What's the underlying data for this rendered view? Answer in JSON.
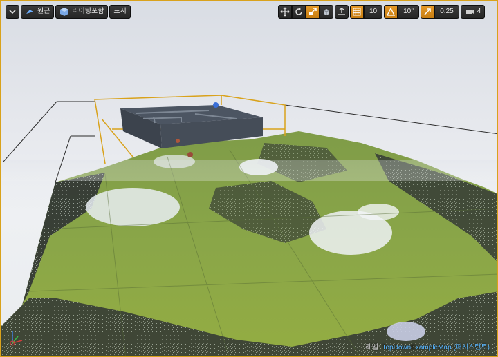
{
  "toolbar": {
    "menu_icon": "chevron-down-icon",
    "view_mode": {
      "label": "원근",
      "icon": "perspective-icon"
    },
    "lighting": {
      "label": "라이팅포함",
      "icon": "lit-sphere-icon"
    },
    "show": {
      "label": "표시"
    },
    "transform_tools": [
      "move-icon",
      "rotate-icon",
      "scale-icon"
    ],
    "world_local_icon": "globe-icon",
    "surface_snap_icon": "surface-snap-icon",
    "grid_snap": {
      "icon": "grid-icon",
      "value": "10"
    },
    "rotation_snap": {
      "icon": "angle-icon",
      "value": "10°"
    },
    "scale_snap": {
      "icon": "scale-arrow-icon",
      "value": "0.25"
    },
    "camera_speed": {
      "icon": "camera-speed-icon",
      "value": "4"
    }
  },
  "viewport": {
    "level_prefix": "레벨:",
    "level_name": "TopDownExampleMap (퍼시스턴트)"
  },
  "colors": {
    "accent": "#e59a2a",
    "selection": "#d9a21b",
    "level_name": "#59b6ff"
  }
}
